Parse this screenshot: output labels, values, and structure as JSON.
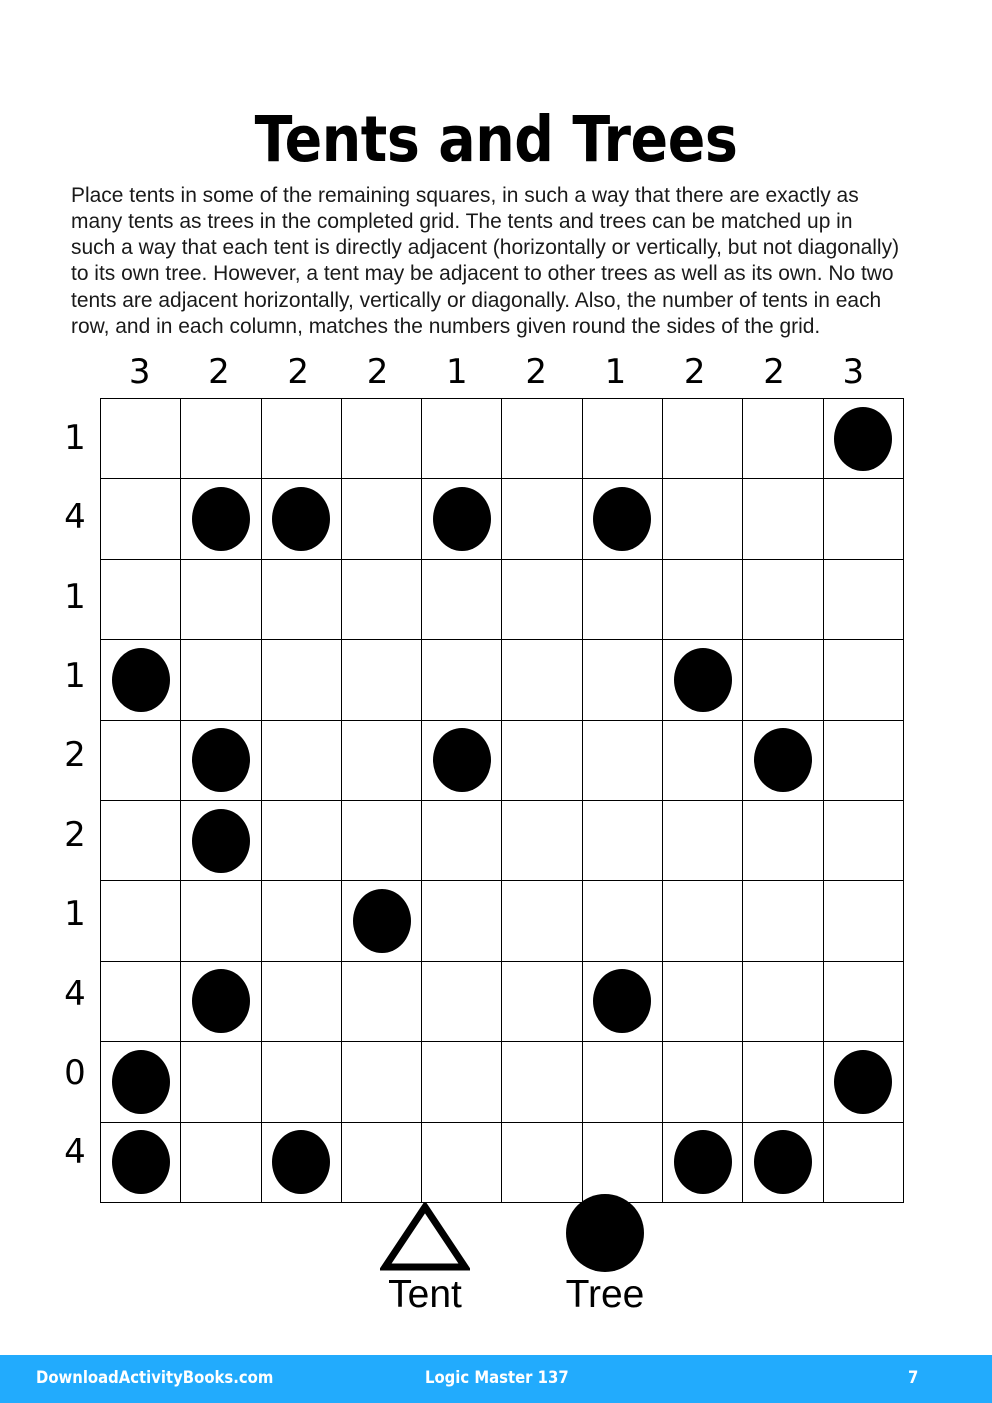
{
  "title": "Tents and Trees",
  "instructions": "Place tents in some of the remaining squares, in such a way that there are exactly as many tents as trees in the completed grid. The tents and trees can be matched up in such a way that each tent is directly adjacent (horizontally or vertically, but not diagonally) to its own tree. However, a tent may be adjacent to other trees as well as its own. No two tents are adjacent horizontally, vertically or diagonally. Also, the number of tents in each row, and in each column, matches the numbers given round the sides of the grid.",
  "puzzle": {
    "rows": 10,
    "cols": 10,
    "column_clues": [
      3,
      2,
      2,
      2,
      1,
      2,
      1,
      2,
      2,
      3
    ],
    "row_clues": [
      1,
      4,
      1,
      1,
      2,
      2,
      1,
      4,
      0,
      4
    ],
    "tree_cells": [
      [
        0,
        9
      ],
      [
        1,
        1
      ],
      [
        1,
        2
      ],
      [
        1,
        4
      ],
      [
        1,
        6
      ],
      [
        3,
        0
      ],
      [
        3,
        7
      ],
      [
        4,
        1
      ],
      [
        4,
        4
      ],
      [
        4,
        8
      ],
      [
        5,
        1
      ],
      [
        6,
        3
      ],
      [
        7,
        1
      ],
      [
        7,
        6
      ],
      [
        8,
        0
      ],
      [
        8,
        9
      ],
      [
        9,
        0
      ],
      [
        9,
        2
      ],
      [
        9,
        7
      ],
      [
        9,
        8
      ]
    ],
    "tree_grid": [
      [
        0,
        0,
        0,
        0,
        0,
        0,
        0,
        0,
        0,
        1
      ],
      [
        0,
        1,
        1,
        0,
        1,
        0,
        1,
        0,
        0,
        0
      ],
      [
        0,
        0,
        0,
        0,
        0,
        0,
        0,
        0,
        0,
        0
      ],
      [
        1,
        0,
        0,
        0,
        0,
        0,
        0,
        1,
        0,
        0
      ],
      [
        0,
        1,
        0,
        0,
        1,
        0,
        0,
        0,
        1,
        0
      ],
      [
        0,
        1,
        0,
        0,
        0,
        0,
        0,
        0,
        0,
        0
      ],
      [
        0,
        0,
        0,
        1,
        0,
        0,
        0,
        0,
        0,
        0
      ],
      [
        0,
        1,
        0,
        0,
        0,
        0,
        1,
        0,
        0,
        0
      ],
      [
        1,
        0,
        0,
        0,
        0,
        0,
        0,
        0,
        0,
        1
      ],
      [
        1,
        0,
        1,
        0,
        0,
        0,
        0,
        1,
        1,
        0
      ]
    ],
    "total_trees": 20
  },
  "legend": {
    "tent": {
      "label": "Tent",
      "icon": "triangle-outline-icon"
    },
    "tree": {
      "label": "Tree",
      "icon": "filled-circle-icon"
    }
  },
  "footer": {
    "site": "DownloadActivityBooks.com",
    "book": "Logic Master 137",
    "page": "7",
    "background_color": "#22abfd",
    "text_color": "#ffffff"
  },
  "colors": {
    "ink": "#000000",
    "paper": "#ffffff",
    "accent": "#22abfd"
  }
}
